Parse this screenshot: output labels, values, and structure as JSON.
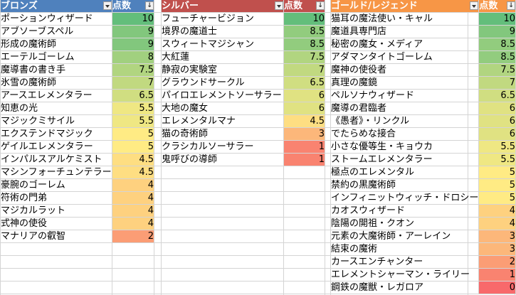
{
  "colors": {
    "bronze_header": "#4f81bd",
    "silver_header": "#c0504d",
    "gold_header": "#f79646",
    "grid": "#d4d4d4"
  },
  "icons": [
    "filter-dropdown-icon",
    "sort-descending-icon"
  ],
  "tables": [
    {
      "header_name": "ブロンズ",
      "header_score": "点数",
      "rows": [
        {
          "name": "ポーションウィザード",
          "score": "10"
        },
        {
          "name": "アブソーブスペル",
          "score": "9"
        },
        {
          "name": "形成の魔術師",
          "score": "9"
        },
        {
          "name": "エーテルゴーレム",
          "score": "8"
        },
        {
          "name": "魔導書の書き手",
          "score": "7.5"
        },
        {
          "name": "氷雪の魔術師",
          "score": "7"
        },
        {
          "name": "アースエレメンタラー",
          "score": "6.5"
        },
        {
          "name": "知恵の光",
          "score": "5.5"
        },
        {
          "name": "マジックミサイル",
          "score": "5.5"
        },
        {
          "name": "エクステンドマジック",
          "score": "5"
        },
        {
          "name": "ゲイルエレメンタラー",
          "score": "5"
        },
        {
          "name": "インパルスアルケミスト",
          "score": "4.5"
        },
        {
          "name": "マシンフォーチュンテラー",
          "score": "4.5"
        },
        {
          "name": "豪腕のゴーレム",
          "score": "4"
        },
        {
          "name": "符術の門弟",
          "score": "4"
        },
        {
          "name": "マジカルラット",
          "score": "4"
        },
        {
          "name": "式神の使役",
          "score": "4"
        },
        {
          "name": "マナリアの叡智",
          "score": "2"
        }
      ]
    },
    {
      "header_name": "シルバー",
      "header_score": "点数",
      "rows": [
        {
          "name": "フューチャービジョン",
          "score": "10"
        },
        {
          "name": "境界の魔道士",
          "score": "8.5"
        },
        {
          "name": "スウィートマジシャン",
          "score": "8.5"
        },
        {
          "name": "大紅蓮",
          "score": "7.5"
        },
        {
          "name": "静寂の実験室",
          "score": "7"
        },
        {
          "name": "グラウンドサークル",
          "score": "6.5"
        },
        {
          "name": "パイロエレメントソーサラー",
          "score": "6"
        },
        {
          "name": "大地の魔女",
          "score": "6"
        },
        {
          "name": "エレメンタルマナ",
          "score": "4.5"
        },
        {
          "name": "猫の奇術師",
          "score": "3"
        },
        {
          "name": "クラシカルソーサラー",
          "score": "1"
        },
        {
          "name": "鬼呼びの導師",
          "score": "1"
        }
      ]
    },
    {
      "header_name": "ゴールド/レジェンド",
      "header_score": "点数",
      "rows": [
        {
          "name": "猫耳の魔法使い・キャル",
          "score": "10"
        },
        {
          "name": "魔道具専門店",
          "score": "9"
        },
        {
          "name": "秘密の魔女・メディア",
          "score": "8.5"
        },
        {
          "name": "アダマンタイトゴーレム",
          "score": "8.5"
        },
        {
          "name": "魔神の使役者",
          "score": "7.5"
        },
        {
          "name": "真理の魔鏡",
          "score": "7"
        },
        {
          "name": "ペルソナウィザード",
          "score": "6.5"
        },
        {
          "name": "魔導の君臨者",
          "score": "6"
        },
        {
          "name": "《愚者》・リンクル",
          "score": "6"
        },
        {
          "name": "でたらめな接合",
          "score": "6"
        },
        {
          "name": "小さな優等生・キョウカ",
          "score": "5.5"
        },
        {
          "name": "ストームエレメンタラー",
          "score": "5.5"
        },
        {
          "name": "極点のエレメンタル",
          "score": "5"
        },
        {
          "name": "禁約の黒魔術師",
          "score": "5"
        },
        {
          "name": "インフィニットウィッチ・ドロシー",
          "score": "5"
        },
        {
          "name": "カオスウィザード",
          "score": "4"
        },
        {
          "name": "陰陽の開祖・クオン",
          "score": "4"
        },
        {
          "name": "元素の大魔術師・アーレイン",
          "score": "3"
        },
        {
          "name": "結束の魔術",
          "score": "3"
        },
        {
          "name": "カースエンチャンター",
          "score": "2"
        },
        {
          "name": "エレメントシャーマン・ライリー",
          "score": "1"
        },
        {
          "name": "鋼鉄の魔獣・レガロア",
          "score": "0"
        }
      ]
    }
  ]
}
